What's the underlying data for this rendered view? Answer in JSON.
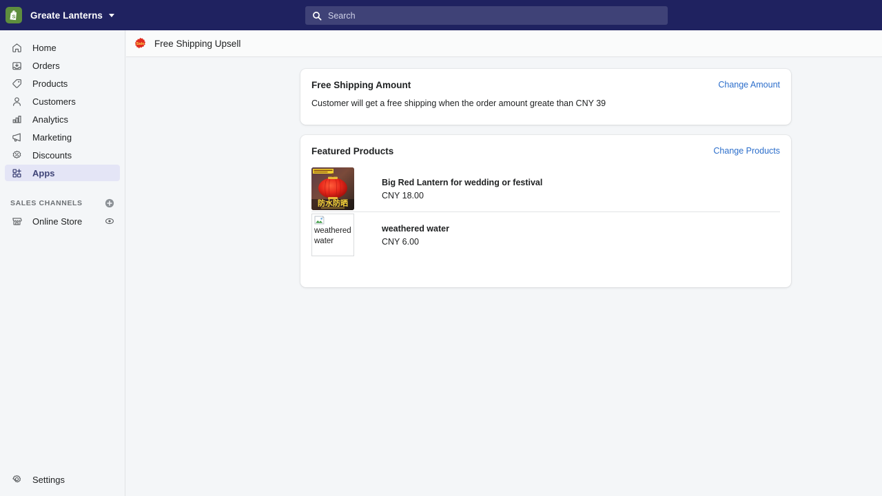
{
  "topbar": {
    "logo_icon": "shopify-bag-icon",
    "store_name": "Greate Lanterns",
    "caret_icon": "chevron-down-icon",
    "search": {
      "icon": "search-icon",
      "placeholder": "Search",
      "value": ""
    }
  },
  "sidebar": {
    "items": [
      {
        "label": "Home",
        "icon": "home-icon",
        "active": false
      },
      {
        "label": "Orders",
        "icon": "orders-icon",
        "active": false
      },
      {
        "label": "Products",
        "icon": "tag-icon",
        "active": false
      },
      {
        "label": "Customers",
        "icon": "person-icon",
        "active": false
      },
      {
        "label": "Analytics",
        "icon": "bar-chart-icon",
        "active": false
      },
      {
        "label": "Marketing",
        "icon": "megaphone-icon",
        "active": false
      },
      {
        "label": "Discounts",
        "icon": "discount-icon",
        "active": false
      },
      {
        "label": "Apps",
        "icon": "apps-grid-icon",
        "active": true
      }
    ],
    "sales_channels": {
      "title": "SALES CHANNELS",
      "add_icon": "plus-circle-icon",
      "items": [
        {
          "label": "Online Store",
          "icon": "store-icon",
          "action_icon": "eye-icon"
        }
      ]
    },
    "settings": {
      "label": "Settings",
      "icon": "gear-icon"
    },
    "active_bg": "#e4e5f6",
    "active_fg": "#3f4477"
  },
  "app_header": {
    "icon": "sale-badge-icon",
    "icon_badge_text": "Sale",
    "title": "Free Shipping Upsell"
  },
  "cards": {
    "free_shipping_amount": {
      "title": "Free Shipping Amount",
      "action_label": "Change Amount",
      "description": "Customer will get a free shipping when the order amount greate than CNY 39"
    },
    "featured_products": {
      "title": "Featured Products",
      "action_label": "Change Products",
      "products": [
        {
          "name": "Big Red Lantern for wedding or festival",
          "price": "CNY 18.00",
          "image_type": "photo",
          "image_name": "red-lantern-product-photo",
          "image_caption": "防水防晒"
        },
        {
          "name": "weathered water",
          "price": "CNY 6.00",
          "image_type": "broken",
          "image_name": "broken-image-placeholder",
          "alt_text": "weathered water"
        }
      ]
    }
  },
  "colors": {
    "topbar": "#1f2260",
    "search_field": "#3f4277",
    "page_bg": "#f4f6f8",
    "card_bg": "#ffffff",
    "link": "#2c6ecb",
    "shopify_green": "#5e8e3e",
    "sale_red": "#e02b20"
  }
}
